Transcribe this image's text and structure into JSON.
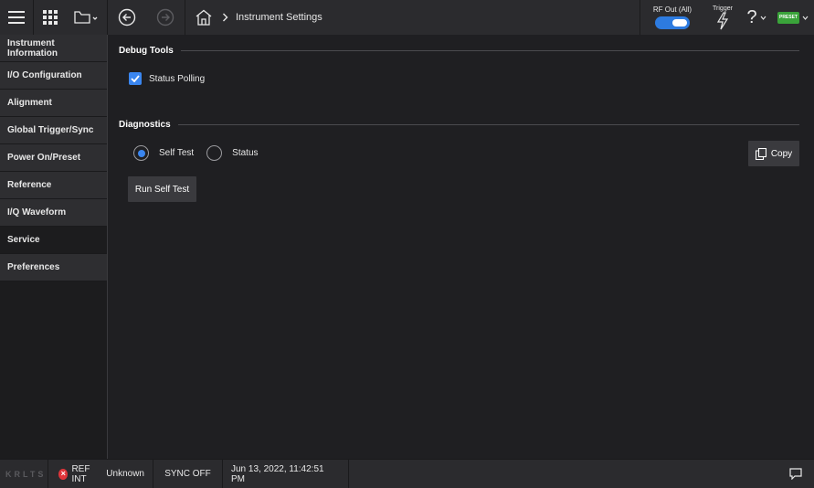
{
  "header": {
    "breadcrumb_current": "Instrument Settings",
    "rf_out_label": "RF Out (All)",
    "rf_out_state": "on",
    "trigger_label": "Trigger",
    "help_icon": "?",
    "preset_label": "PRESET"
  },
  "sidebar": {
    "items": [
      {
        "label": "Instrument Information"
      },
      {
        "label": "I/O Configuration"
      },
      {
        "label": "Alignment"
      },
      {
        "label": "Global Trigger/Sync"
      },
      {
        "label": "Power On/Preset"
      },
      {
        "label": "Reference"
      },
      {
        "label": "I/Q Waveform"
      },
      {
        "label": "Service"
      },
      {
        "label": "Preferences"
      }
    ],
    "active": "Service"
  },
  "debug_tools": {
    "title": "Debug Tools",
    "status_polling_label": "Status Polling",
    "status_polling_checked": true
  },
  "diagnostics": {
    "title": "Diagnostics",
    "options": [
      {
        "label": "Self Test",
        "selected": true
      },
      {
        "label": "Status",
        "selected": false
      }
    ],
    "copy_label": "Copy",
    "run_label": "Run Self Test"
  },
  "statusbar": {
    "logo": "KRLTS",
    "ref_label": "REF INT",
    "ref_status": "Unknown",
    "sync": "SYNC OFF",
    "datetime": "Jun 13, 2022, 11:42:51 PM"
  },
  "colors": {
    "accent": "#3a86f0",
    "preset": "#3aa33a",
    "error": "#e0353a"
  }
}
